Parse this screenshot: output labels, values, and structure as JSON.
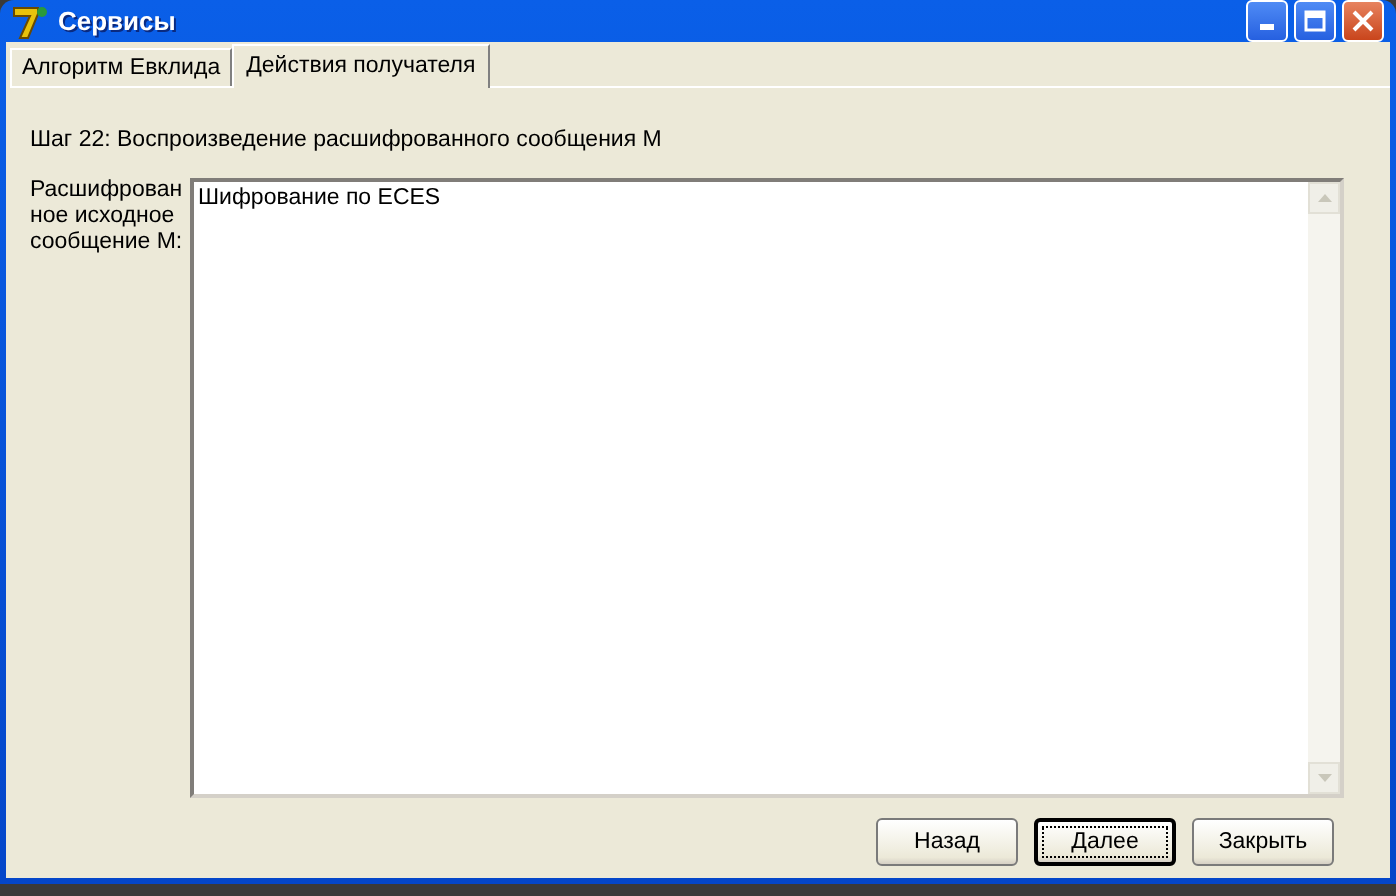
{
  "window": {
    "title": "Сервисы"
  },
  "tabs": [
    {
      "label": "Алгоритм Евклида",
      "selected": false
    },
    {
      "label": "Действия получателя",
      "selected": true
    }
  ],
  "step": "Шаг 22: Воспроизведение расшифрованного сообщения М",
  "field": {
    "label": "Расшифрованное исходное сообщение М:",
    "value": "Шифрование по ECES"
  },
  "buttons": [
    {
      "label": "Назад",
      "focused": false
    },
    {
      "label": "Далее",
      "focused": true
    },
    {
      "label": "Закрыть",
      "focused": false
    }
  ]
}
